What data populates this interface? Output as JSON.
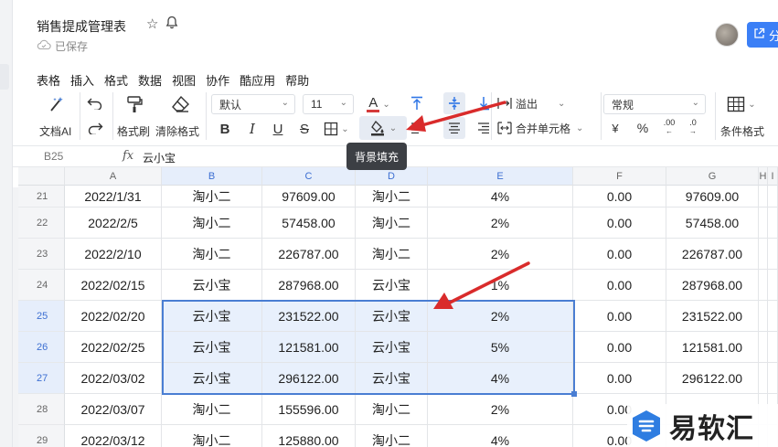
{
  "document": {
    "title": "销售提成管理表",
    "save_status": "已保存",
    "share_label": "分"
  },
  "menu": [
    "表格",
    "插入",
    "格式",
    "数据",
    "视图",
    "协作",
    "酷应用",
    "帮助"
  ],
  "toolbar": {
    "ai_label": "文档AI",
    "format_painter_label": "格式刷",
    "clear_format_label": "清除格式",
    "font_name": "默认",
    "font_size": "11",
    "wrap_label": "溢出",
    "merge_label": "合并单元格",
    "number_format": "常规",
    "conditional_format_label": "条件格式",
    "bold": "B",
    "italic": "I",
    "underline": "U",
    "strike": "S",
    "font_color_glyph": "A",
    "currency": "¥",
    "percent": "%",
    "decimal_more": ".00",
    "decimal_less": ".0"
  },
  "tooltip": "背景填充",
  "formula_bar": {
    "cell_ref": "B25",
    "fx": "fx",
    "value": "云小宝"
  },
  "columns": [
    "A",
    "B",
    "C",
    "D",
    "E",
    "F",
    "G",
    "H",
    "I"
  ],
  "rows": [
    {
      "num": "21",
      "cells": [
        "2022/1/31",
        "淘小二",
        "97609.00",
        "淘小二",
        "4%",
        "0.00",
        "97609.00"
      ]
    },
    {
      "num": "22",
      "cells": [
        "2022/2/5",
        "淘小二",
        "57458.00",
        "淘小二",
        "2%",
        "0.00",
        "57458.00"
      ]
    },
    {
      "num": "23",
      "cells": [
        "2022/2/10",
        "淘小二",
        "226787.00",
        "淘小二",
        "2%",
        "0.00",
        "226787.00"
      ]
    },
    {
      "num": "24",
      "cells": [
        "2022/02/15",
        "云小宝",
        "287968.00",
        "云小宝",
        "1%",
        "0.00",
        "287968.00"
      ]
    },
    {
      "num": "25",
      "cells": [
        "2022/02/20",
        "云小宝",
        "231522.00",
        "云小宝",
        "2%",
        "0.00",
        "231522.00"
      ]
    },
    {
      "num": "26",
      "cells": [
        "2022/02/25",
        "云小宝",
        "121581.00",
        "云小宝",
        "5%",
        "0.00",
        "121581.00"
      ]
    },
    {
      "num": "27",
      "cells": [
        "2022/03/02",
        "云小宝",
        "296122.00",
        "云小宝",
        "4%",
        "0.00",
        "296122.00"
      ]
    },
    {
      "num": "28",
      "cells": [
        "2022/03/07",
        "淘小二",
        "155596.00",
        "淘小二",
        "2%",
        "0.00",
        ""
      ]
    },
    {
      "num": "29",
      "cells": [
        "2022/03/12",
        "淘小二",
        "125880.00",
        "淘小二",
        "4%",
        "0.00",
        ""
      ]
    }
  ],
  "watermark": "易软汇",
  "colors": {
    "accent": "#3b7ff6",
    "selection_fill": "#e8f0fc",
    "selection_border": "#4a7ed3",
    "arrow": "#d92b2b"
  }
}
